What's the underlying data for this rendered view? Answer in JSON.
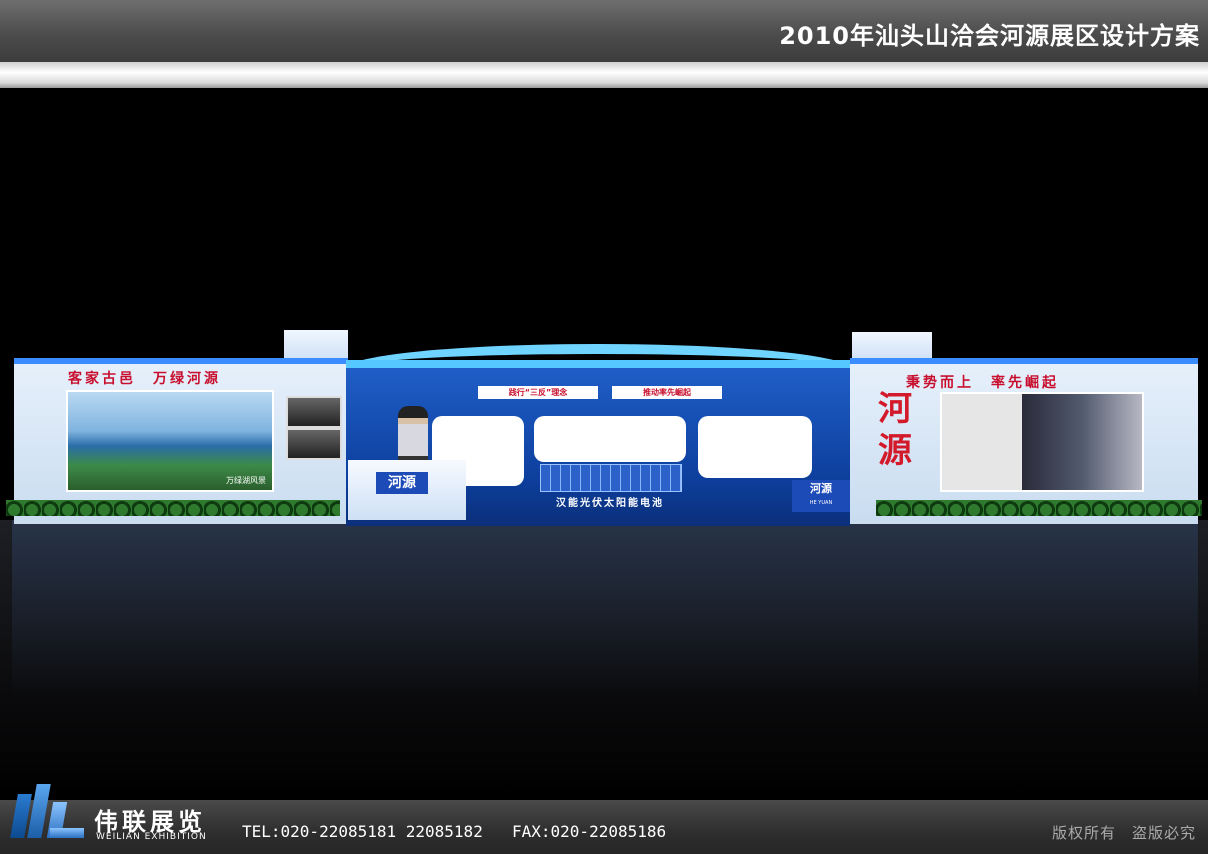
{
  "header": {
    "title": "2010年汕头山洽会河源展区设计方案"
  },
  "booth": {
    "left_slogan": "客家古邑　万绿河源",
    "right_slogan": "秉势而上　率先崛起",
    "big_title": "河源",
    "lake_caption": "万绿湖风景",
    "banner_left": "践行“三反”理念",
    "banner_right": "推动率先崛起",
    "solar_label": "汉能光伏太阳能电池",
    "counter_left": "河源",
    "counter_right": "河源",
    "counter_right_sub": "HE YUAN"
  },
  "footer": {
    "brand_cn": "伟联展览",
    "brand_en": "WEILIAN EXHIBITION",
    "tel": "TEL:020-22085181 22085182",
    "fax": "FAX:020-22085186",
    "rights": "版权所有　盗版必究"
  },
  "colors": {
    "accent_blue": "#3a8cff",
    "slogan_red": "#c8102e"
  }
}
